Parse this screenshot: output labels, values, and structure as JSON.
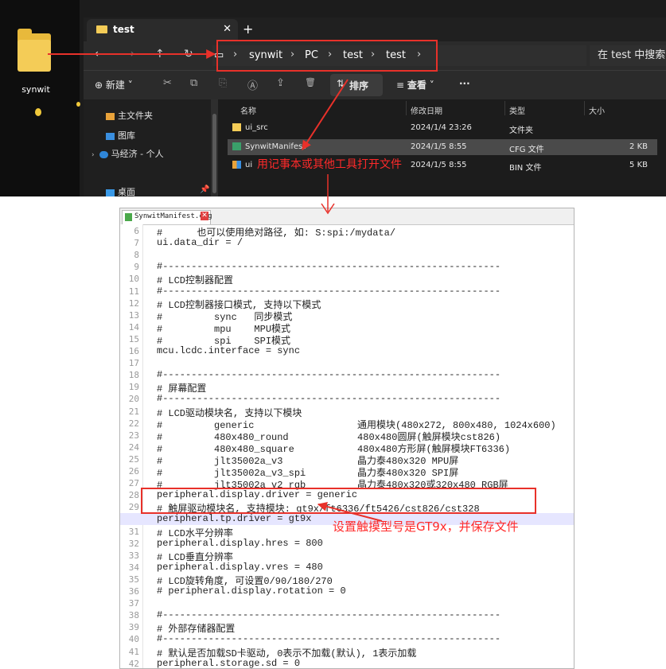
{
  "desktop": {
    "folder_label": "synwit"
  },
  "explorer": {
    "tab_title": "test",
    "tab_close": "✕",
    "tab_new": "+",
    "nav": {
      "back": "←",
      "forward": "→",
      "up": "↑",
      "refresh": "↻",
      "monitor": "▭"
    },
    "breadcrumb": [
      "synwit",
      "PC",
      "test",
      "test"
    ],
    "crumb_sep": "›",
    "search_placeholder": "在 test 中搜索",
    "toolbar": {
      "new_label": "新建",
      "cut_icon": "✂",
      "copy_icon": "⧉",
      "paste_icon": "⎘",
      "rename_icon": "Ⓐ",
      "share_icon": "⇪",
      "delete_icon": "🗑",
      "sort_label": "排序",
      "view_label": "查看",
      "more_label": "···"
    },
    "navpane": [
      "主文件夹",
      "图库",
      "马经济 - 个人",
      "桌面"
    ],
    "columns": [
      "名称",
      "修改日期",
      "类型",
      "大小"
    ],
    "files": [
      {
        "name": "ui_src",
        "date": "2024/1/4 23:26",
        "type": "文件夹",
        "size": ""
      },
      {
        "name": "SynwitManifest",
        "date": "2024/1/5 8:55",
        "type": "CFG 文件",
        "size": "2 KB"
      },
      {
        "name": "ui",
        "date": "2024/1/5 8:55",
        "type": "BIN 文件",
        "size": "5 KB"
      }
    ],
    "annotation": "用记事本或其他工具打开文件"
  },
  "editor": {
    "tab_title": "SynwitManifest.cfg",
    "tab_close": "✕",
    "lines": [
      {
        "n": "6",
        "text": "#      也可以使用绝对路径, 如: S:spi:/mydata/"
      },
      {
        "n": "7",
        "text": "ui.data_dir = /"
      },
      {
        "n": "8",
        "text": ""
      },
      {
        "n": "9",
        "text": "#-----------------------------------------------------------"
      },
      {
        "n": "10",
        "text": "# LCD控制器配置"
      },
      {
        "n": "11",
        "text": "#-----------------------------------------------------------"
      },
      {
        "n": "12",
        "text": "# LCD控制器接口模式, 支持以下模式"
      },
      {
        "n": "13",
        "text": "#         sync   同步模式"
      },
      {
        "n": "14",
        "text": "#         mpu    MPU模式"
      },
      {
        "n": "15",
        "text": "#         spi    SPI模式"
      },
      {
        "n": "16",
        "text": "mcu.lcdc.interface = sync"
      },
      {
        "n": "17",
        "text": ""
      },
      {
        "n": "18",
        "text": "#-----------------------------------------------------------"
      },
      {
        "n": "19",
        "text": "# 屏幕配置"
      },
      {
        "n": "20",
        "text": "#-----------------------------------------------------------"
      },
      {
        "n": "21",
        "text": "# LCD驱动模块名, 支持以下模块"
      },
      {
        "n": "22",
        "text": "#         generic                  通用模块(480x272, 800x480, 1024x600)"
      },
      {
        "n": "23",
        "text": "#         480x480_round            480x480圆屏(触屏模块cst826)"
      },
      {
        "n": "24",
        "text": "#         480x480_square           480x480方形屏(触屏模块FT6336)"
      },
      {
        "n": "25",
        "text": "#         jlt35002a_v3             晶力泰480x320 MPU屏"
      },
      {
        "n": "26",
        "text": "#         jlt35002a_v3_spi         晶力泰480x320 SPI屏"
      },
      {
        "n": "27",
        "text": "#         jlt35002a_v2_rgb         晶力泰480x320或320x480 RGB屏"
      },
      {
        "n": "28",
        "text": "peripheral.display.driver = generic"
      },
      {
        "n": "29",
        "text": "# 触屏驱动模块名, 支持模块: gt9x/ft6336/ft5426/cst826/cst328"
      },
      {
        "n": "30",
        "text": "peripheral.tp.driver = gt9x"
      },
      {
        "n": "31",
        "text": "# LCD水平分辨率"
      },
      {
        "n": "32",
        "text": "peripheral.display.hres = 800"
      },
      {
        "n": "33",
        "text": "# LCD垂直分辨率"
      },
      {
        "n": "34",
        "text": "peripheral.display.vres = 480"
      },
      {
        "n": "35",
        "text": "# LCD旋转角度, 可设置0/90/180/270"
      },
      {
        "n": "36",
        "text": "# peripheral.display.rotation = 0"
      },
      {
        "n": "37",
        "text": ""
      },
      {
        "n": "38",
        "text": "#-----------------------------------------------------------"
      },
      {
        "n": "39",
        "text": "# 外部存储器配置"
      },
      {
        "n": "40",
        "text": "#-----------------------------------------------------------"
      },
      {
        "n": "41",
        "text": "# 默认是否加载SD卡驱动, 0表示不加载(默认), 1表示加载"
      },
      {
        "n": "42",
        "text": "peripheral.storage.sd = 0"
      }
    ],
    "annotation": "设置触摸型号是GT9x，并保存文件"
  },
  "colors": {
    "annotation_red": "#e8312a",
    "current_line": "#e6e6ff"
  }
}
